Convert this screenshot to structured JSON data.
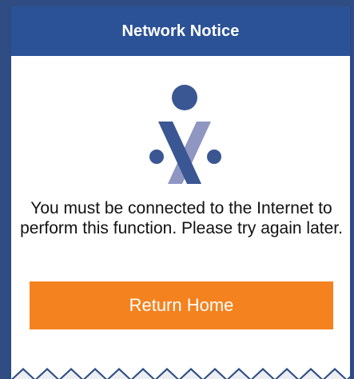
{
  "dialog": {
    "title": "Network Notice",
    "message": "You must be connected to the Internet to perform this function. Please try again later.",
    "return_home_label": "Return Home"
  },
  "colors": {
    "header": "#2b5296",
    "button": "#f4821f",
    "logo_dark": "#3a5693",
    "logo_light": "#8f96c2"
  },
  "icons": {
    "logo": "app-logo-icon"
  }
}
